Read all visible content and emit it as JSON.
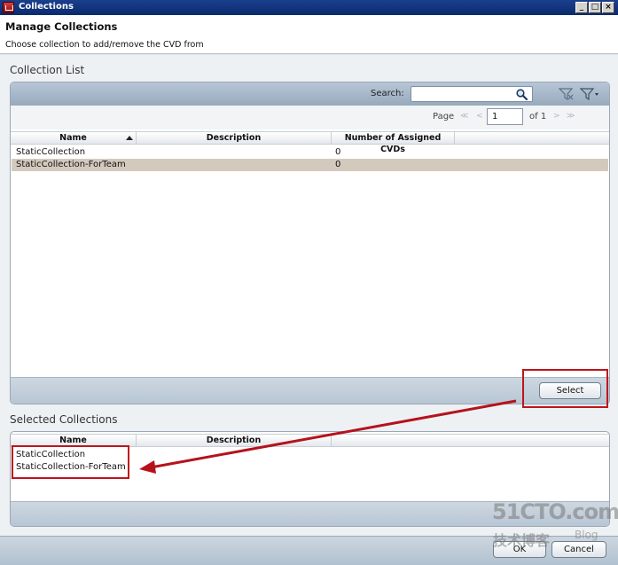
{
  "window": {
    "title": "Collections"
  },
  "header": {
    "title": "Manage Collections",
    "subtitle": "Choose collection to add/remove the CVD from"
  },
  "collection_list": {
    "label": "Collection List",
    "search_label": "Search:",
    "search_value": "",
    "page_label": "Page",
    "page_value": "1",
    "page_total": "of 1",
    "columns": [
      "Name",
      "Description",
      "Number of Assigned CVDs"
    ],
    "rows": [
      {
        "name": "StaticCollection",
        "description": "",
        "count": "0",
        "selected": false
      },
      {
        "name": "StaticCollection-ForTeam",
        "description": "",
        "count": "0",
        "selected": true
      }
    ],
    "select_button": "Select"
  },
  "selected_collections": {
    "label": "Selected Collections",
    "columns": [
      "Name",
      "Description"
    ],
    "rows": [
      {
        "name": "StaticCollection"
      },
      {
        "name": "StaticCollection-ForTeam"
      }
    ]
  },
  "buttons": {
    "ok": "OK",
    "cancel": "Cancel"
  },
  "watermark": {
    "line1": "51CTO.com",
    "line2": "技术博客",
    "line3": "Blog"
  },
  "colors": {
    "annotation": "#c0141c",
    "selected_row": "#d4c9bd",
    "titlebar": "#0b2a6e"
  }
}
